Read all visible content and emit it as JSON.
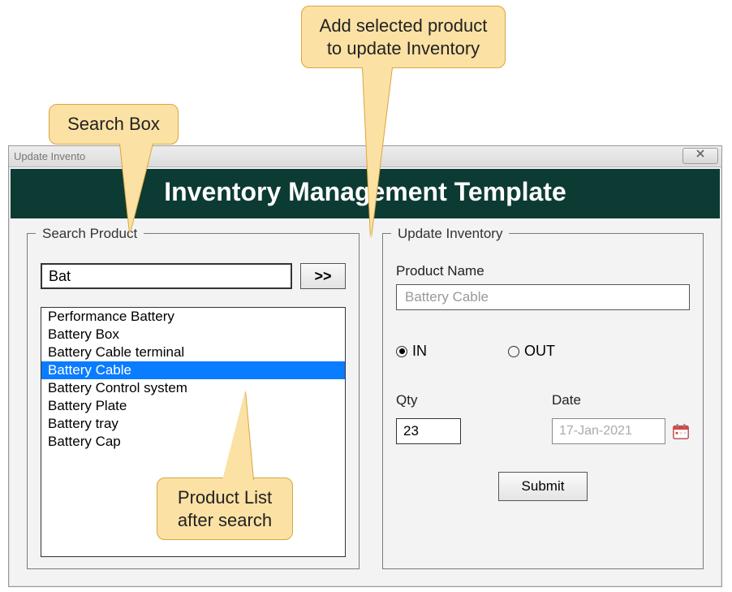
{
  "window": {
    "title": "Update Invento"
  },
  "banner": {
    "title": "Inventory Management Template"
  },
  "search": {
    "legend": "Search Product",
    "value": "Bat",
    "add_label": ">>",
    "items": [
      {
        "label": "Performance Battery",
        "selected": false
      },
      {
        "label": "Battery Box",
        "selected": false
      },
      {
        "label": "Battery Cable terminal",
        "selected": false
      },
      {
        "label": "Battery Cable",
        "selected": true
      },
      {
        "label": "Battery Control system",
        "selected": false
      },
      {
        "label": "Battery Plate",
        "selected": false
      },
      {
        "label": "Battery tray",
        "selected": false
      },
      {
        "label": "Battery Cap",
        "selected": false
      }
    ]
  },
  "update": {
    "legend": "Update Inventory",
    "product_label": "Product Name",
    "product_value": "Battery Cable",
    "radio_in": "IN",
    "radio_out": "OUT",
    "radio_selected": "IN",
    "qty_label": "Qty",
    "qty_value": "23",
    "date_label": "Date",
    "date_value": "17-Jan-2021",
    "submit_label": "Submit"
  },
  "callouts": {
    "search_box": "Search Box",
    "add_button": "Add selected product to update Inventory",
    "product_list": "Product List after search"
  }
}
